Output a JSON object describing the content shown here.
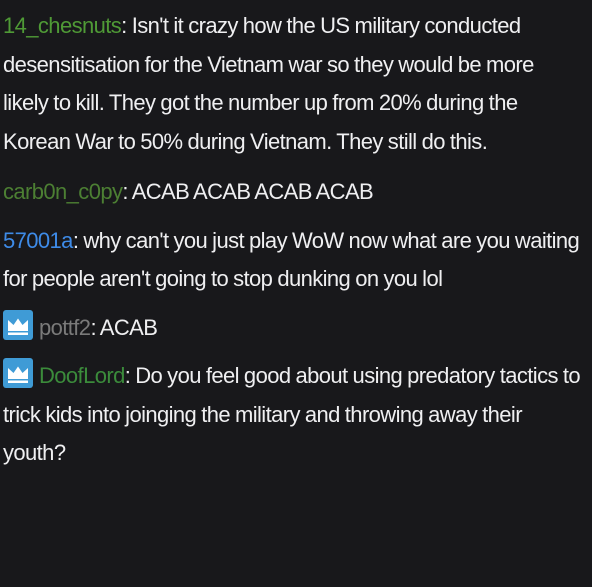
{
  "colors": {
    "background": "#18181b",
    "text": "#efeff1",
    "badge": "#3f9bd6"
  },
  "messages": [
    {
      "username": "14_chesnuts",
      "color": "#4f9a36",
      "badge": null,
      "text": "Isn't it crazy how the US military conducted desensitisation for the Vietnam war so they would be more likely to kill. They got the number up from 20% during the Korean War to 50% during Vietnam. They still do this."
    },
    {
      "username": "carb0n_c0py",
      "color": "#4c7f33",
      "badge": null,
      "text": "ACAB ACAB ACAB ACAB"
    },
    {
      "username": "57001a",
      "color": "#3e8be8",
      "badge": null,
      "text": "why can't you just play WoW now what are you waiting for people aren't going to stop dunking on you lol"
    },
    {
      "username": "pottf2",
      "color": "#7a7a7a",
      "badge": "crown-icon",
      "text": "ACAB"
    },
    {
      "username": "DoofLord",
      "color": "#3b8b3b",
      "badge": "crown-icon",
      "text": "Do you feel good about using predatory tactics to trick kids into joinging the military and throwing away their youth?"
    }
  ]
}
